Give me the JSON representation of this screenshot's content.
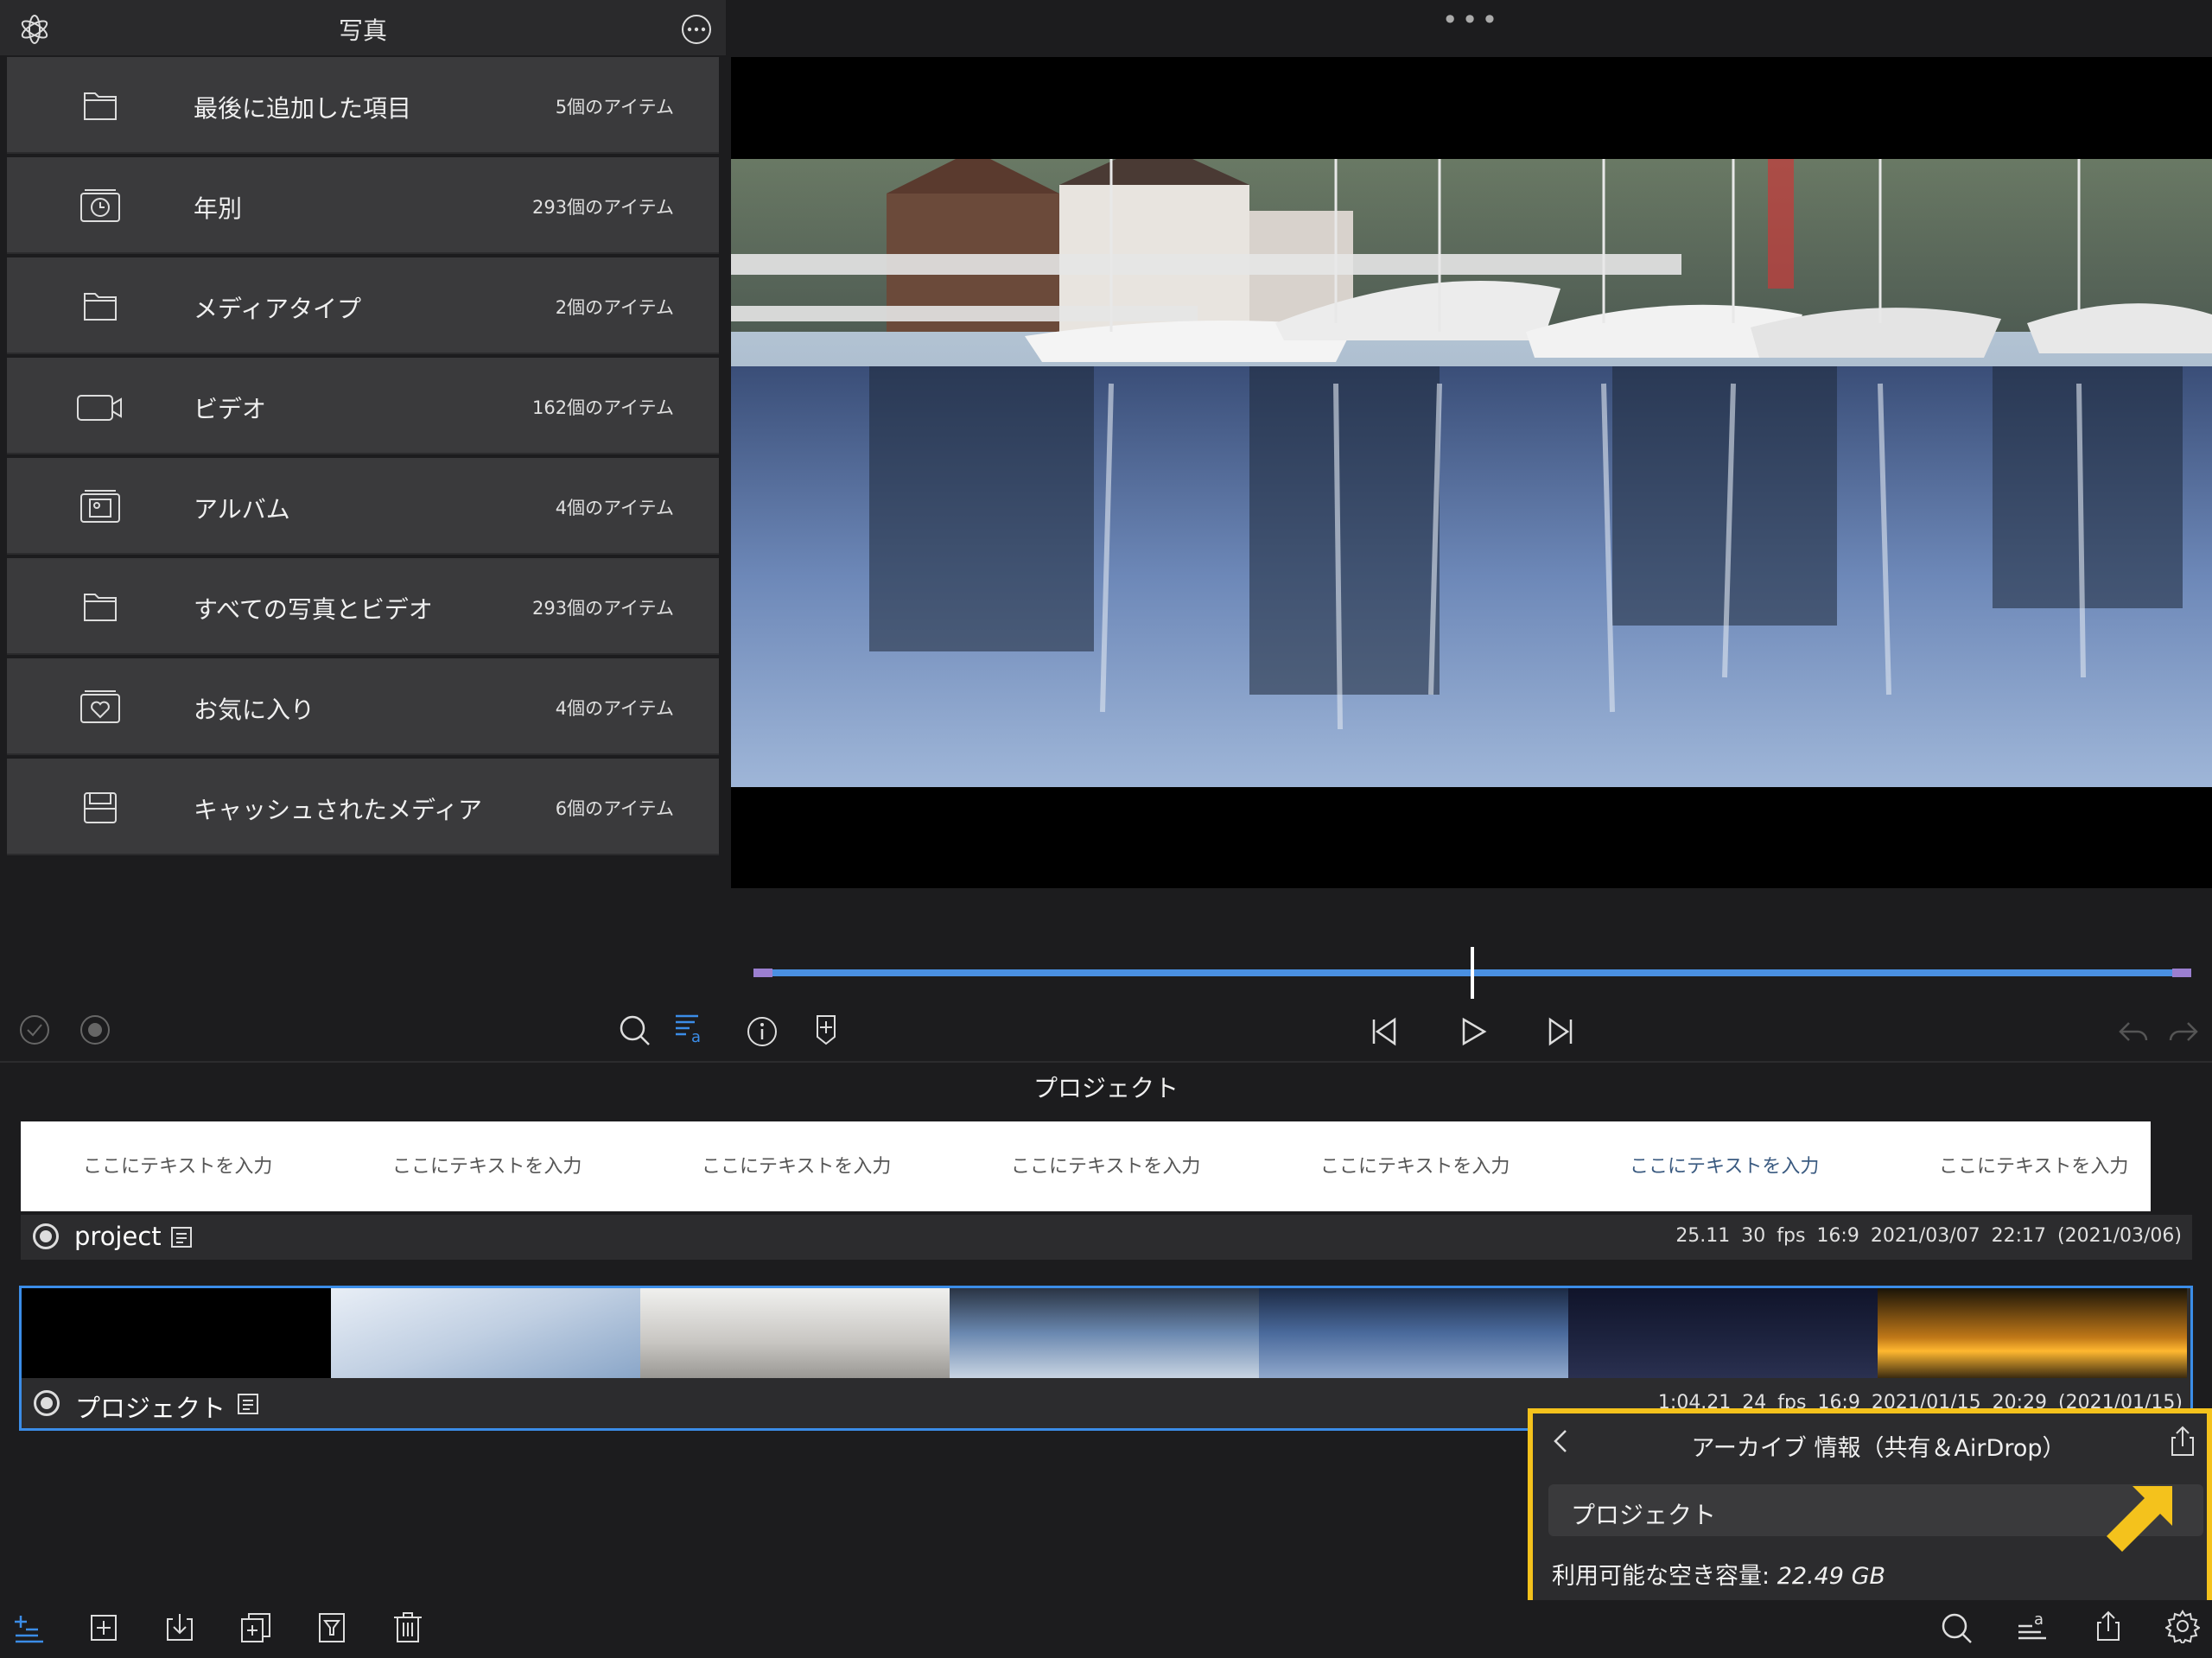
{
  "library": {
    "title": "写真",
    "items": [
      {
        "icon": "folder-icon",
        "label": "最後に追加した項目",
        "count": "5個のアイテム"
      },
      {
        "icon": "calendar-clock-icon",
        "label": "年別",
        "count": "293個のアイテム"
      },
      {
        "icon": "folder-icon",
        "label": "メディアタイプ",
        "count": "2個のアイテム"
      },
      {
        "icon": "video-camera-icon",
        "label": "ビデオ",
        "count": "162個のアイテム"
      },
      {
        "icon": "photo-album-icon",
        "label": "アルバム",
        "count": "4個のアイテム"
      },
      {
        "icon": "folder-icon",
        "label": "すべての写真とビデオ",
        "count": "293個のアイテム"
      },
      {
        "icon": "heart-album-icon",
        "label": "お気に入り",
        "count": "4個のアイテム"
      },
      {
        "icon": "cache-box-icon",
        "label": "キャッシュされたメディア",
        "count": "6個のアイテム"
      }
    ]
  },
  "viewer": {
    "dots": "•••",
    "playhead_position": 0.5,
    "colors": {
      "scrub_track": "#4a90e2",
      "scrub_ends": "#9b7fd0",
      "playhead": "#ffffff"
    }
  },
  "project_section": {
    "title": "プロジェクト",
    "title_strip": [
      "ここにテキストを入力",
      "ここにテキストを入力",
      "ここにテキストを入力",
      "ここにテキストを入力",
      "ここにテキストを入力",
      "ここにテキストを入力",
      "ここにテキストを入力"
    ],
    "projects": [
      {
        "name": "project",
        "meta": "25.11  30 fps  16:9  2021/03/07 22:17  (2021/03/06)"
      },
      {
        "name": "プロジェクト",
        "meta": "1:04.21  24 fps  16:9  2021/01/15 20:29  (2021/01/15)"
      }
    ]
  },
  "archive_popup": {
    "title": "アーカイブ 情報（共有＆AirDrop）",
    "field_value": "プロジェクト",
    "space_label": "利用可能な空き容量: ",
    "space_value": "22.49 GB",
    "highlight_color": "#f4c21c"
  }
}
